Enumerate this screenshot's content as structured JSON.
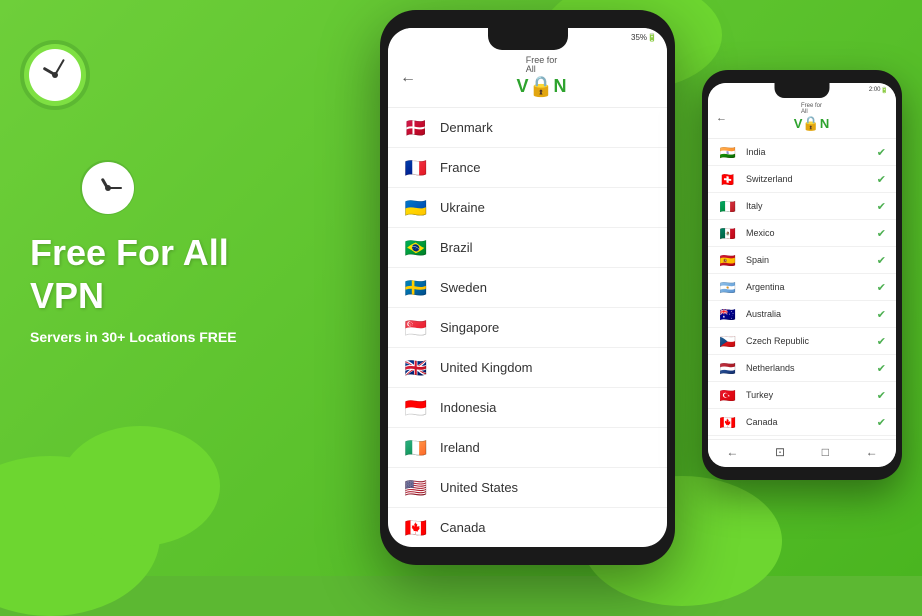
{
  "background": {
    "color": "#5cb832"
  },
  "left_section": {
    "title_line1": "Free For All",
    "title_line2": "VPN",
    "subtitle": "Servers in 30+ Locations FREE"
  },
  "large_phone": {
    "status_bar": "35%",
    "header": {
      "back": "←",
      "logo_line1": "Free for",
      "logo_line2": "All",
      "vpn_text": "V🔒N"
    },
    "countries": [
      {
        "flag": "🇩🇰",
        "name": "Denmark"
      },
      {
        "flag": "🇫🇷",
        "name": "France"
      },
      {
        "flag": "🇺🇦",
        "name": "Ukraine"
      },
      {
        "flag": "🇧🇷",
        "name": "Brazil"
      },
      {
        "flag": "🇸🇪",
        "name": "Sweden"
      },
      {
        "flag": "🇸🇬",
        "name": "Singapore"
      },
      {
        "flag": "🇬🇧",
        "name": "United Kingdom"
      },
      {
        "flag": "🇮🇩",
        "name": "Indonesia"
      },
      {
        "flag": "🇮🇪",
        "name": "Ireland"
      },
      {
        "flag": "🇺🇸",
        "name": "United States"
      },
      {
        "flag": "🇨🇦",
        "name": "Canada"
      }
    ]
  },
  "small_phone": {
    "status_bar": "2:00",
    "header": {
      "back": "←",
      "logo_line1": "Free for",
      "logo_line2": "All",
      "vpn_text": "V🔒N"
    },
    "countries": [
      {
        "flag": "🇮🇳",
        "name": "India"
      },
      {
        "flag": "🇨🇭",
        "name": "Switzerland"
      },
      {
        "flag": "🇮🇹",
        "name": "Italy"
      },
      {
        "flag": "🇲🇽",
        "name": "Mexico"
      },
      {
        "flag": "🇪🇸",
        "name": "Spain"
      },
      {
        "flag": "🇦🇷",
        "name": "Argentina"
      },
      {
        "flag": "🇦🇺",
        "name": "Australia"
      },
      {
        "flag": "🇨🇿",
        "name": "Czech Republic"
      },
      {
        "flag": "🇳🇱",
        "name": "Netherlands"
      },
      {
        "flag": "🇹🇷",
        "name": "Turkey"
      },
      {
        "flag": "🇨🇦",
        "name": "Canada"
      }
    ],
    "bottom_nav": [
      "←",
      "⊡",
      "□",
      "←"
    ]
  }
}
